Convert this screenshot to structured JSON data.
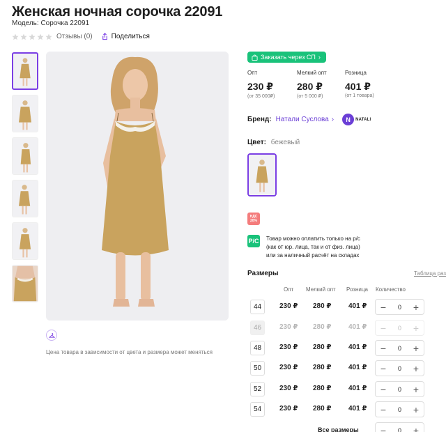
{
  "product": {
    "title": "Женская ночная сорочка 22091",
    "model": "Модель: Сорочка 22091",
    "reviews": "Отзывы (0)",
    "share": "Поделиться",
    "price_note": "Цена товара в зависимости от цвета и размера может меняться"
  },
  "sp_button": "Заказать через СП",
  "prices": [
    {
      "label": "Опт",
      "value": "230 ₽",
      "sub": "(от 35 000₽)"
    },
    {
      "label": "Мелкий опт",
      "value": "280 ₽",
      "sub": "(от 5 000 ₽)"
    },
    {
      "label": "Розница",
      "value": "401 ₽",
      "sub": "(от 1 товара)"
    }
  ],
  "brand": {
    "label": "Бренд:",
    "value": "Натали Суслова",
    "logo_letter": "N",
    "logo_text": "NATALI"
  },
  "color": {
    "label": "Цвет:",
    "value": "бежевый",
    "swatch": "#c9a35e"
  },
  "vat": {
    "line1": "НДС",
    "line2": "20%"
  },
  "payment": {
    "badge": "Р/С",
    "lines": [
      "Товар можно оплатить только на р/с",
      "(как от юр. лица, так и от физ. лица)",
      "или за наличный расчёт на складах"
    ]
  },
  "sizes": {
    "title": "Размеры",
    "table_link": "Таблица разм",
    "headers": {
      "opt": "Опт",
      "small_opt": "Мелкий опт",
      "retail": "Розница",
      "qty": "Количество"
    },
    "rows": [
      {
        "size": "44",
        "opt": "230 ₽",
        "small_opt": "280 ₽",
        "retail": "401 ₽",
        "qty": "0"
      },
      {
        "size": "46",
        "opt": "230 ₽",
        "small_opt": "280 ₽",
        "retail": "401 ₽",
        "qty": "0"
      },
      {
        "size": "48",
        "opt": "230 ₽",
        "small_opt": "280 ₽",
        "retail": "401 ₽",
        "qty": "0"
      },
      {
        "size": "50",
        "opt": "230 ₽",
        "small_opt": "280 ₽",
        "retail": "401 ₽",
        "qty": "0"
      },
      {
        "size": "52",
        "opt": "230 ₽",
        "small_opt": "280 ₽",
        "retail": "401 ₽",
        "qty": "0"
      },
      {
        "size": "54",
        "opt": "230 ₽",
        "small_opt": "280 ₽",
        "retail": "401 ₽",
        "qty": "0"
      }
    ],
    "all_label": "Все размеры",
    "all_qty": "0",
    "minus": "−",
    "plus": "+"
  },
  "colors": {
    "accent": "#7b3fe4",
    "green": "#19c27a",
    "dress": "#c9a35e"
  }
}
